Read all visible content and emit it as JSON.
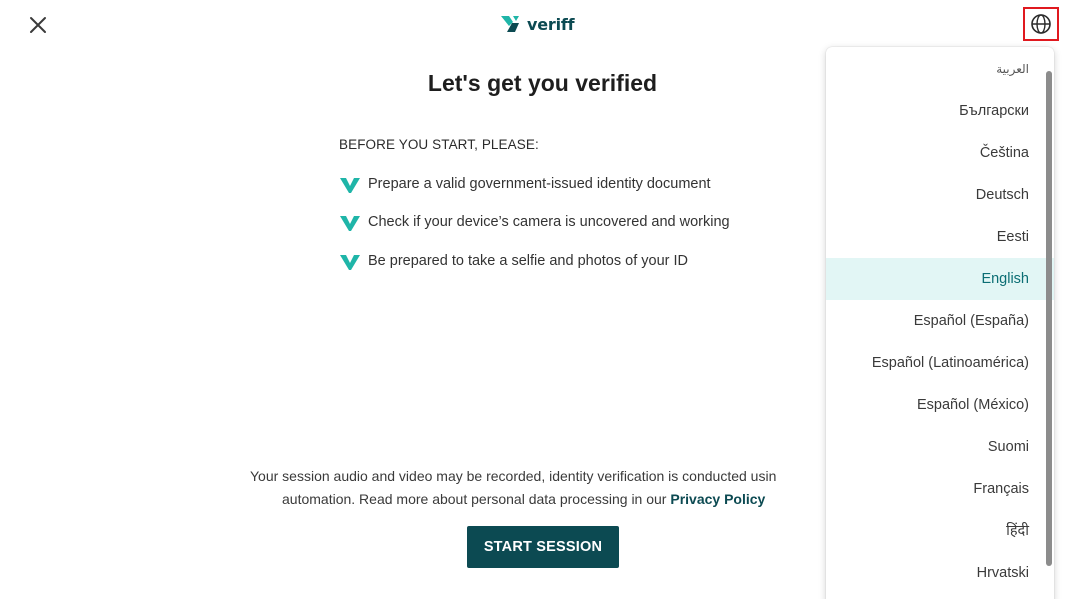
{
  "header": {
    "close_label": "×",
    "logo_text": "veriff",
    "language_button_icon": "globe-icon"
  },
  "main": {
    "title": "Let's get you verified",
    "before_heading": "BEFORE YOU START, PLEASE:",
    "checklist": [
      "Prepare a valid government-issued identity document",
      "Check if your device’s camera is uncovered and working",
      "Be prepared to take a selfie and photos of your ID"
    ],
    "notice_line1": "Your session audio and video may be recorded, identity verification is conducted usin",
    "notice_line2_prefix": "automation. Read more about personal data processing in our ",
    "privacy_link": "Privacy Policy",
    "start_button": "START SESSION"
  },
  "language_menu": {
    "selected": "English",
    "items": [
      "العربية",
      "Български",
      "Čeština",
      "Deutsch",
      "Eesti",
      "English",
      "Español (España)",
      "Español (Latinoamérica)",
      "Español (México)",
      "Suomi",
      "Français",
      "हिंदी",
      "Hrvatski"
    ]
  },
  "colors": {
    "brand_dark": "#0c4a52",
    "brand_teal": "#1fb5a8",
    "selected_bg": "#e2f6f5",
    "highlight_border": "#e0191f"
  }
}
